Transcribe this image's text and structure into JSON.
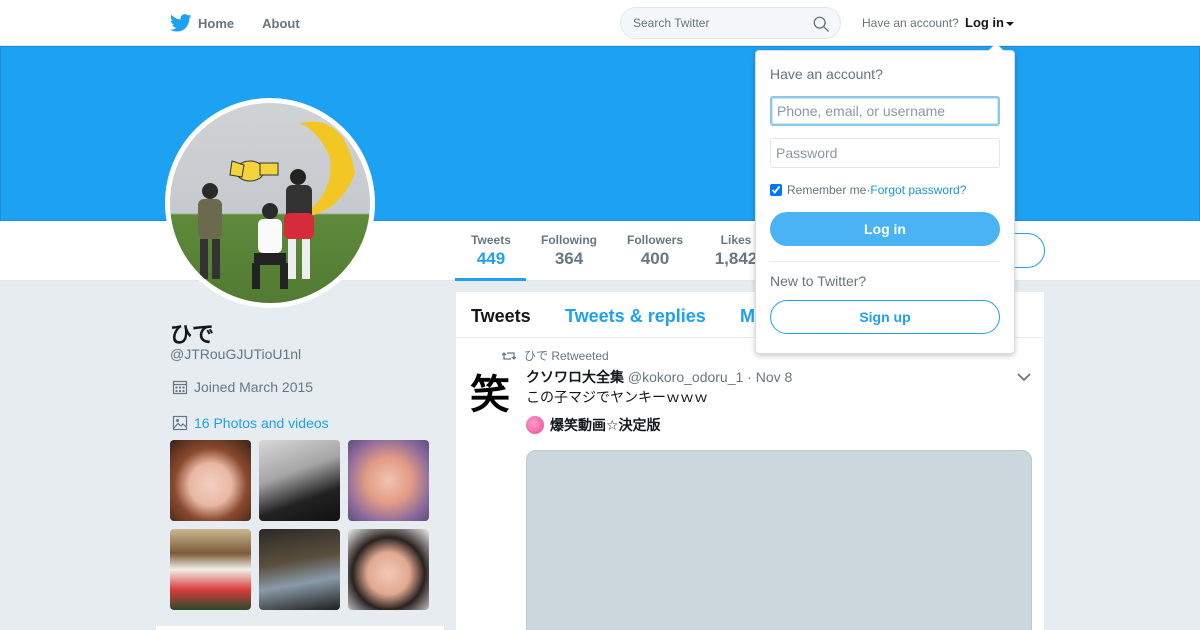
{
  "nav": {
    "home_label": "Home",
    "about_label": "About",
    "search_placeholder": "Search Twitter",
    "have_account": "Have an account?",
    "login_label": "Log in"
  },
  "profile": {
    "name": "ひで",
    "handle": "@JTRouGJUTioU1nl",
    "joined": "Joined March 2015",
    "photos_link": "16 Photos and videos"
  },
  "stats": [
    {
      "label": "Tweets",
      "value": "449"
    },
    {
      "label": "Following",
      "value": "364"
    },
    {
      "label": "Followers",
      "value": "400"
    },
    {
      "label": "Likes",
      "value": "1,842"
    }
  ],
  "timeline": {
    "tabs": [
      "Tweets",
      "Tweets & replies",
      "M"
    ],
    "tweet": {
      "retweeted_by": "ひで Retweeted",
      "author_avatar_char": "笑",
      "author_name": "クソワロ大全集",
      "author_meta": "@kokoro_odoru_1 · Nov 8",
      "text": "この子マジでヤンキーｗｗｗ",
      "sub_text": "爆笑動画☆決定版"
    }
  },
  "login_dropdown": {
    "title": "Have an account?",
    "username_placeholder": "Phone, email, or username",
    "password_placeholder": "Password",
    "remember_label": "Remember me",
    "separator": " · ",
    "forgot_label": "Forgot password?",
    "login_button": "Log in",
    "new_label": "New to Twitter?",
    "signup_button": "Sign up"
  },
  "colors": {
    "accent": "#1da1f2",
    "banner": "#1da1f2",
    "background": "#e6ecf0"
  }
}
